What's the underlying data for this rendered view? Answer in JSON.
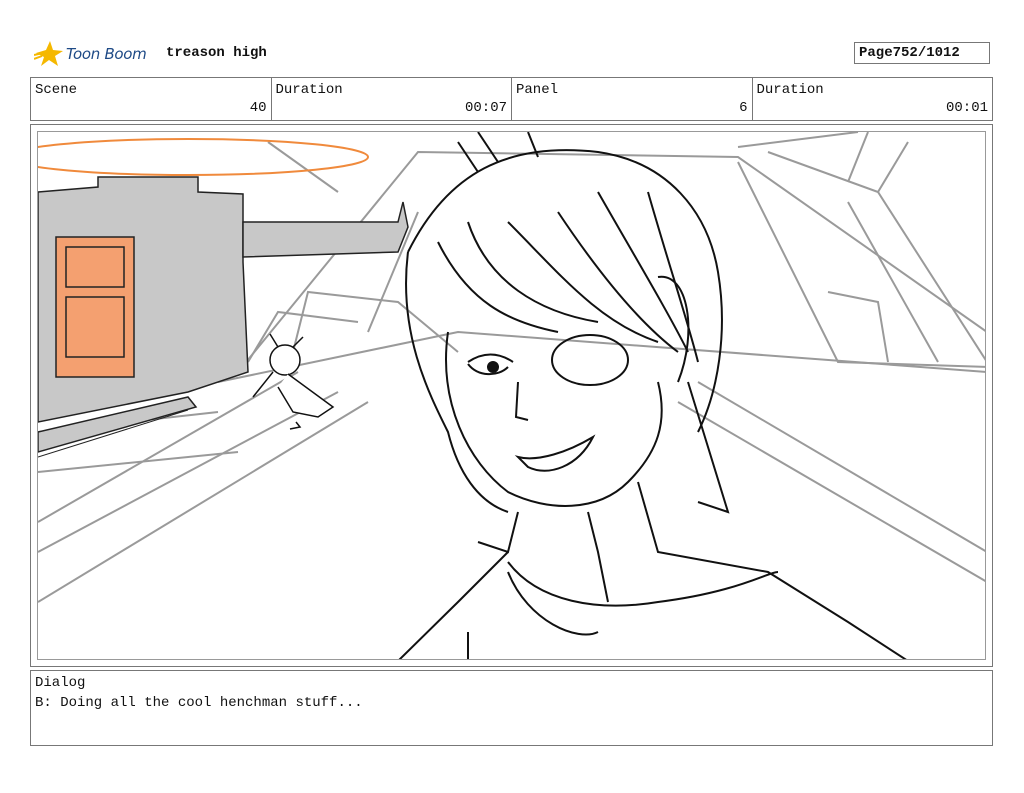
{
  "header": {
    "logo_text": "Toon Boom",
    "project_title": "treason high",
    "page_label": "Page",
    "page_value": "752/1012"
  },
  "info": {
    "scene_label": "Scene",
    "scene_value": "40",
    "duration1_label": "Duration",
    "duration1_value": "00:07",
    "panel_label": "Panel",
    "panel_value": "6",
    "duration2_label": "Duration",
    "duration2_value": "00:01"
  },
  "dialog": {
    "label": "Dialog",
    "text": "B: Doing all the cool henchman stuff..."
  },
  "colors": {
    "logo_blue": "#1e4a86",
    "logo_star": "#f5b800",
    "accent_orange": "#f08a3c",
    "machine_gray": "#c8c8c8"
  }
}
